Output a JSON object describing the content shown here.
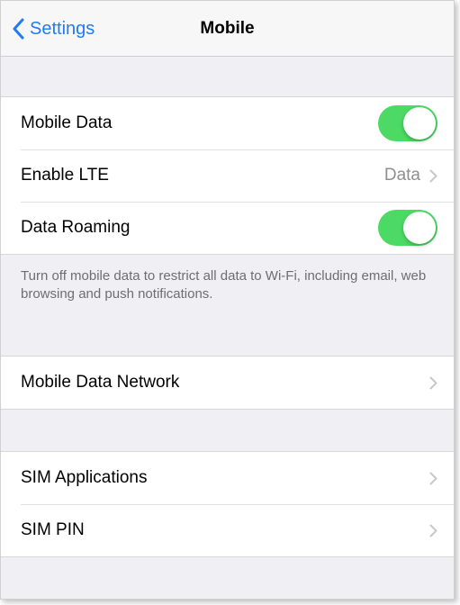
{
  "navbar": {
    "back_label": "Settings",
    "title": "Mobile"
  },
  "group1": {
    "mobile_data": {
      "label": "Mobile Data",
      "on": true
    },
    "enable_lte": {
      "label": "Enable LTE",
      "value": "Data"
    },
    "data_roaming": {
      "label": "Data Roaming",
      "on": true
    }
  },
  "footer_note": "Turn off mobile data to restrict all data to Wi-Fi, including email, web browsing and push notifications.",
  "group2": {
    "mobile_data_network": {
      "label": "Mobile Data Network"
    }
  },
  "group3": {
    "sim_applications": {
      "label": "SIM Applications"
    },
    "sim_pin": {
      "label": "SIM PIN"
    }
  },
  "colors": {
    "accent": "#1f7cf2",
    "toggle_on": "#4cd964",
    "background": "#efeff4"
  }
}
